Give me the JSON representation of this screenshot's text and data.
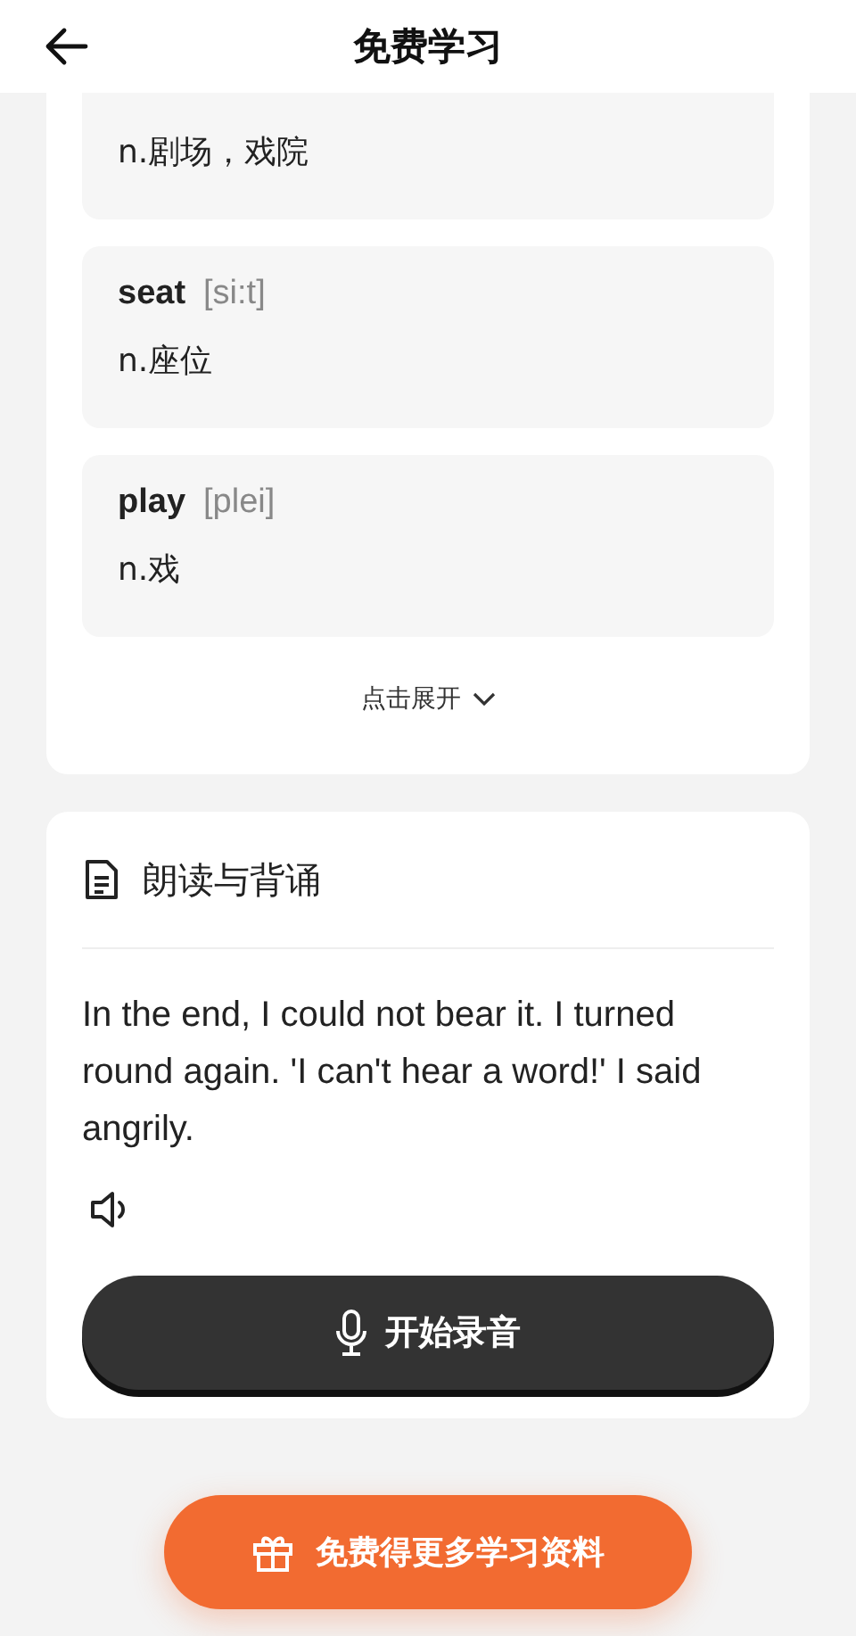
{
  "header": {
    "title": "免费学习"
  },
  "words": [
    {
      "meaning": "n.剧场，戏院"
    },
    {
      "word": "seat",
      "phonetic": "[si:t]",
      "meaning": "n.座位"
    },
    {
      "word": "play",
      "phonetic": "[plei]",
      "meaning": "n.戏"
    }
  ],
  "expand": {
    "label": "点击展开"
  },
  "reading": {
    "title": "朗读与背诵",
    "text": "In the end, I could not bear it. I turned round again. 'I can't hear a word!' I said angrily.",
    "record_button": "开始录音"
  },
  "cta": {
    "label": "免费得更多学习资料"
  }
}
